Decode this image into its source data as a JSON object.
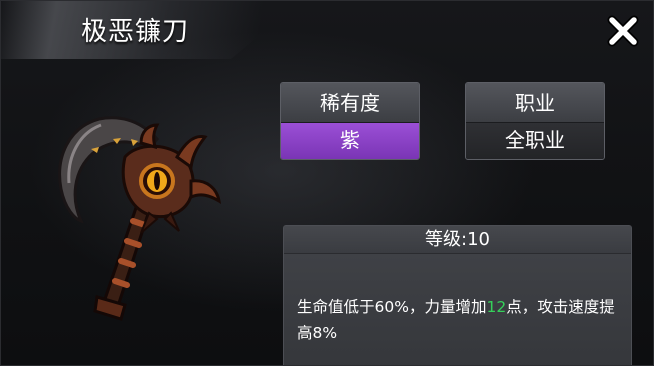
{
  "item": {
    "name": "极恶镰刀",
    "icon": "demon-scythe-icon"
  },
  "attributes": {
    "rarity": {
      "label": "稀有度",
      "value": "紫",
      "color": "#8a44c8"
    },
    "job": {
      "label": "职业",
      "value": "全职业"
    }
  },
  "info": {
    "level": "等级:10",
    "desc_before": "生命值低于60%，力量增加",
    "desc_highlight": "12",
    "desc_after": "点，攻击速度提高8%",
    "highlight_color": "#35d05a"
  },
  "close_icon": "close-icon"
}
